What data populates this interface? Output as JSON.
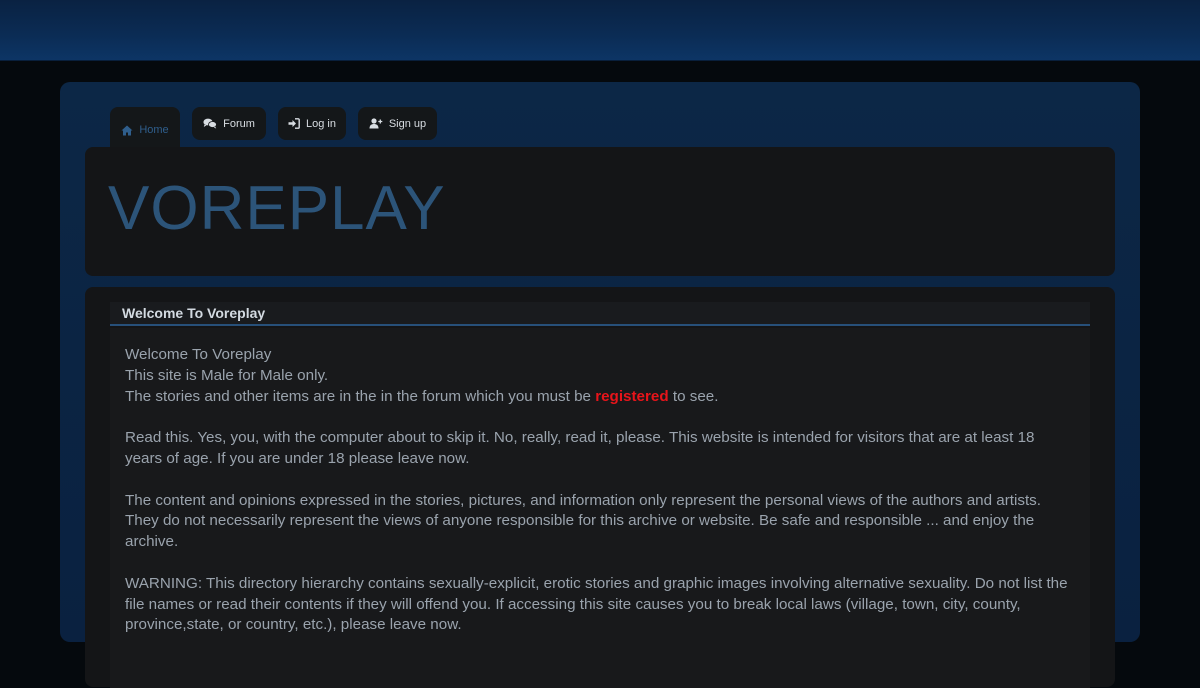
{
  "nav": {
    "tabs": [
      {
        "label": "Home",
        "icon": "home-icon"
      },
      {
        "label": "Forum",
        "icon": "chat-bubbles-icon"
      },
      {
        "label": "Log in",
        "icon": "sign-in-icon"
      },
      {
        "label": "Sign up",
        "icon": "user-plus-icon"
      }
    ]
  },
  "site": {
    "title": "VOREPLAY"
  },
  "welcome": {
    "heading": "Welcome To Voreplay",
    "line1": "Welcome To Voreplay",
    "line2": "This site is Male for Male only.",
    "line3_before": "The stories and other items are in the in the forum which you must be ",
    "line3_link": "registered",
    "line3_after": " to see.",
    "para2": "Read this. Yes, you, with the computer about to skip it. No, really, read it, please. This website is intended for visitors that are at least 18 years of age. If you are under 18 please leave now.",
    "para3": "The content and opinions expressed in the stories, pictures, and information only represent the personal views of the authors and artists. They do not necessarily represent the views of anyone responsible for this archive or website. Be safe and responsible ... and enjoy the archive.",
    "para4": "WARNING: This directory hierarchy contains sexually-explicit, erotic stories and graphic images involving alternative sexuality. Do not list the file names or read their contents if they will offend you. If accessing this site causes you to break local laws (village, town, city, county, province,state, or country, etc.), please leave now."
  },
  "colors": {
    "accent": "#2c5479",
    "link_red": "#e8141a",
    "topbar": "#0b2c55"
  }
}
